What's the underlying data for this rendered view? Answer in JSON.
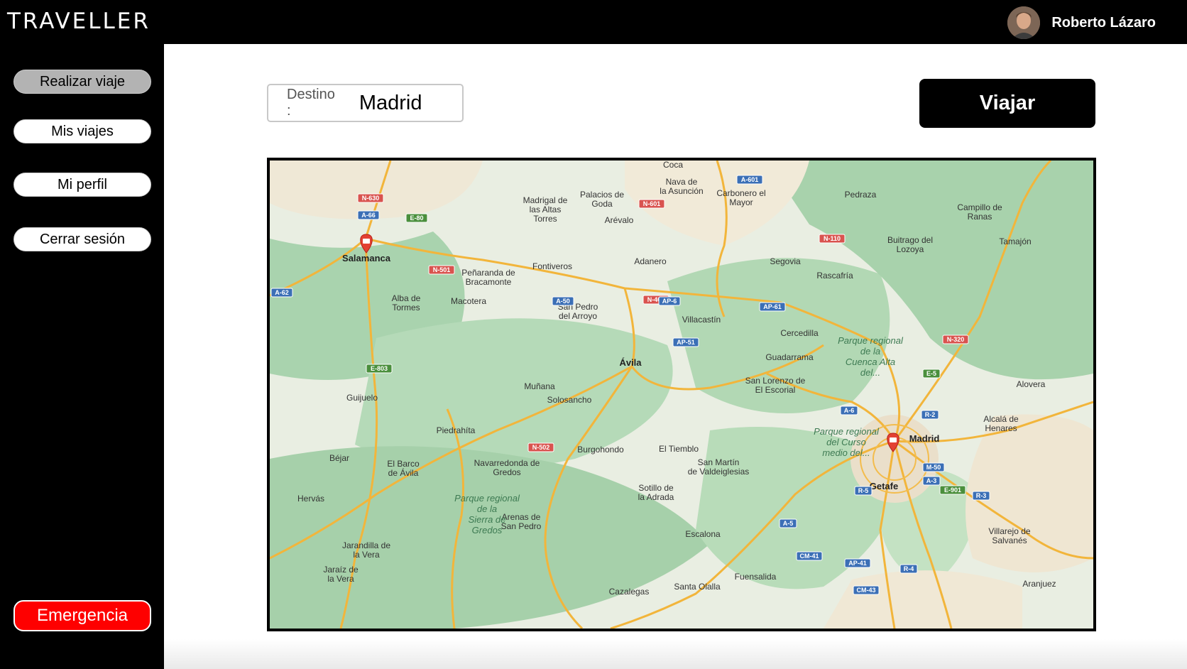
{
  "app": {
    "logo": "TRAVELLER"
  },
  "user": {
    "name": "Roberto Lázaro"
  },
  "sidebar": {
    "items": [
      {
        "label": "Realizar viaje",
        "active": true
      },
      {
        "label": "Mis viajes",
        "active": false
      },
      {
        "label": "Mi perfil",
        "active": false
      },
      {
        "label": "Cerrar sesión",
        "active": false
      }
    ],
    "emergency_label": "Emergencia"
  },
  "search": {
    "label": "Destino :",
    "value": "Madrid"
  },
  "actions": {
    "travel_label": "Viajar"
  },
  "map": {
    "places": [
      "Coca",
      "Nava de la Asunción",
      "Carbonero el Mayor",
      "Pedraza",
      "Campillo de Ranas",
      "Tamajón",
      "Madrigal de las Altas Torres",
      "Palacios de Goda",
      "Arévalo",
      "Salamanca",
      "Peñaranda de Bracamonte",
      "Fontiveros",
      "Adanero",
      "Segovia",
      "Rascafría",
      "Buitrago del Lozoya",
      "Alba de Tormes",
      "Macotera",
      "San Pedro del Arroyo",
      "Villacastín",
      "Cercedilla",
      "Guadarrama",
      "Ávila",
      "Muñana",
      "Solosancho",
      "San Lorenzo de El Escorial",
      "Alovera",
      "Guijuelo",
      "Piedrahíta",
      "Alcalá de Henares",
      "Madrid",
      "Burgohondo",
      "El Tiemblo",
      "Béjar",
      "El Barco de Ávila",
      "Navarredonda de Gredos",
      "San Martín de Valdeiglesias",
      "Getafe",
      "Hervás",
      "Sotillo de la Adrada",
      "Arenas de San Pedro",
      "Escalona",
      "Villarejo de Salvanés",
      "Jarandilla de la Vera",
      "Jaraíz de la Vera",
      "Fuensalida",
      "Cazalegas",
      "Santa Olalla",
      "Aranjuez"
    ],
    "parks": [
      "Parque regional de la Cuenca Alta del...",
      "Parque regional del Curso medio del...",
      "Parque regional de la Sierra de Gredos"
    ],
    "roads": [
      "N-630",
      "A-66",
      "E-80",
      "N-501",
      "A-62",
      "N-601",
      "A-601",
      "N-110",
      "A-50",
      "N-403",
      "AP-6",
      "AP-61",
      "AP-51",
      "N-320",
      "E-5",
      "E-803",
      "A-6",
      "R-2",
      "M-50",
      "A-3",
      "R-5",
      "E-901",
      "R-3",
      "N-502",
      "A-5",
      "CM-41",
      "AP-41",
      "R-4",
      "CM-43"
    ],
    "destination_marker": "Madrid",
    "origin_marker": "Salamanca"
  }
}
